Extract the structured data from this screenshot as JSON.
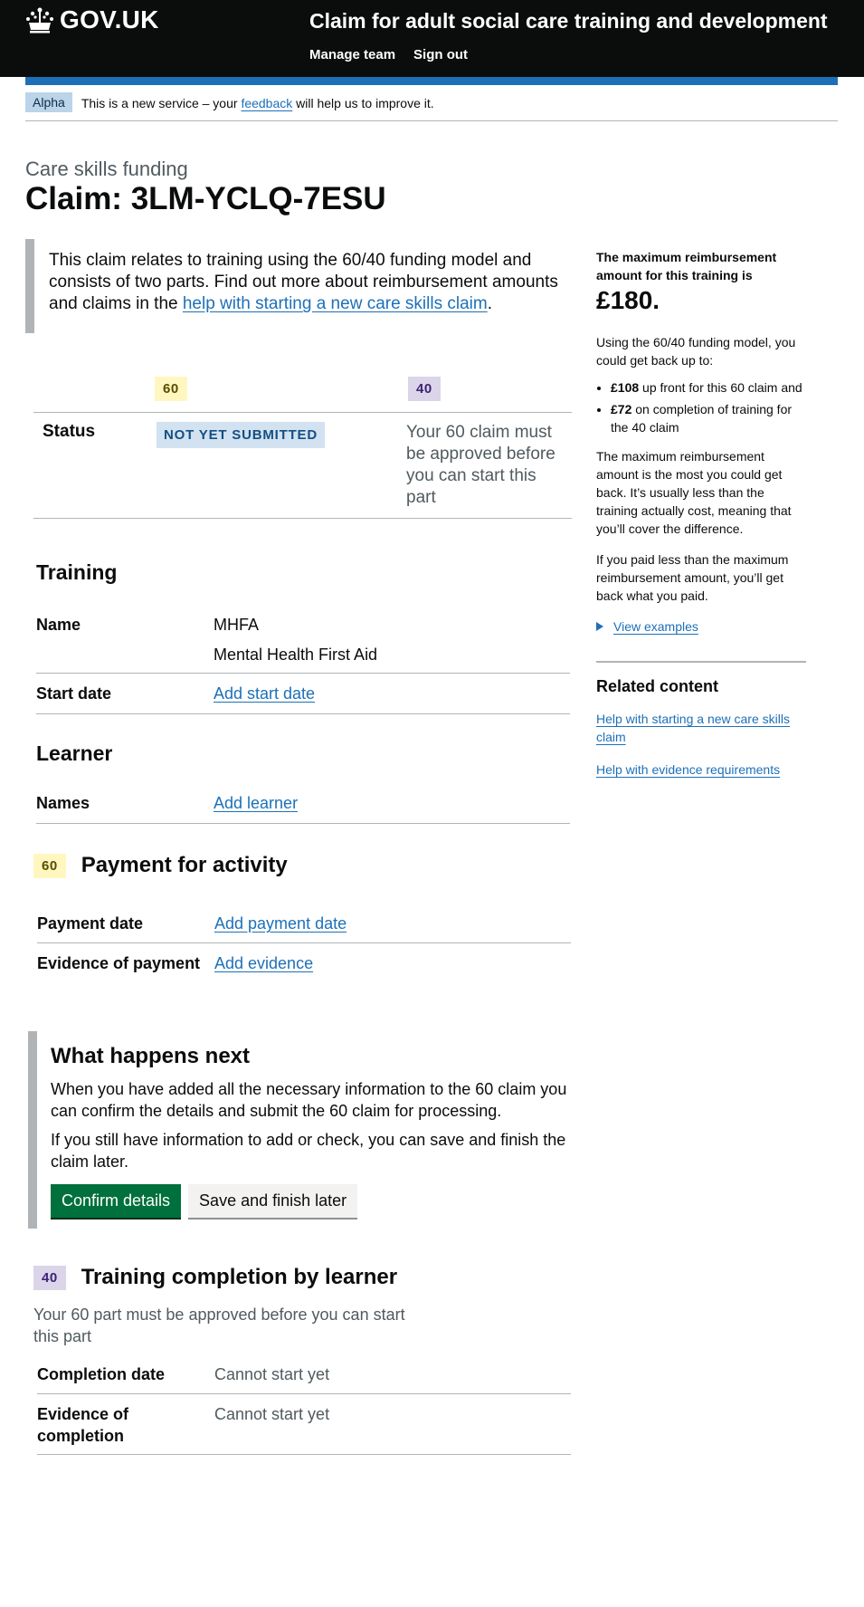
{
  "header": {
    "logo_text": "GOV.UK",
    "service_name": "Claim for adult social care training and development",
    "nav": [
      "Manage team",
      "Sign out"
    ],
    "accent_color": "#1d70b8"
  },
  "phase_banner": {
    "tag": "Alpha",
    "text_before": "This is a new service – your ",
    "link": "feedback",
    "text_after": " will help us to improve it."
  },
  "page": {
    "caption": "Care skills funding",
    "title": "Claim: 3LM-YCLQ-7ESU"
  },
  "inset": {
    "text": "This claim relates to training using the 60/40 funding model and consists of two parts. Find out more about reimbursement amounts and claims in the ",
    "link": "help with starting a new care skills claim",
    "after": "."
  },
  "status_table": {
    "col_60": "60",
    "col_40": "40",
    "row_label": "Status",
    "status_60": "NOT YET SUBMITTED",
    "status_40": "Your 60 claim must be approved before you can start this part"
  },
  "training": {
    "heading": "Training",
    "name_label": "Name",
    "name_code": "MHFA",
    "name_full": "Mental Health First Aid",
    "start_label": "Start date",
    "start_link": "Add start date"
  },
  "learner": {
    "heading": "Learner",
    "names_label": "Names",
    "names_link": "Add learner"
  },
  "payment": {
    "tag": "60",
    "heading": "Payment for activity",
    "date_label": "Payment date",
    "date_link": "Add payment date",
    "evidence_label": "Evidence of payment",
    "evidence_link": "Add evidence"
  },
  "next": {
    "heading": "What happens next",
    "p1": "When you have added all the necessary information to the 60 claim you can confirm the details and submit the 60 claim for processing.",
    "p2": "If you still have information to add or check, you can save and finish the claim later.",
    "confirm": "Confirm details",
    "save": "Save and  finish later"
  },
  "completion": {
    "tag": "40",
    "heading": "Training completion by learner",
    "note": "Your 60 part must be approved before you can start this part",
    "date_label": "Completion date",
    "date_value": "Cannot start yet",
    "evidence_label": "Evidence of completion",
    "evidence_value": "Cannot start yet"
  },
  "sidebar": {
    "lead": "The maximum reimbursement amount for this training is",
    "amount": "£180.",
    "intro": "Using the 60/40 funding model, you could get back up to:",
    "b1_amount": "£108",
    "b1_text": " up front for this 60 claim and",
    "b2_amount": "£72",
    "b2_text": " on completion of training for the 40 claim",
    "p1": "The maximum reimbursement amount is the most you could get back. It’s usually less than the training actually cost, meaning that you’ll cover the difference.",
    "p2": "If you paid less than the maximum reimbursement amount, you’ll get back what you paid.",
    "details": "View examples",
    "related_heading": "Related content",
    "related_1": "Help with starting a new care skills claim",
    "related_2": "Help with evidence requirements"
  }
}
